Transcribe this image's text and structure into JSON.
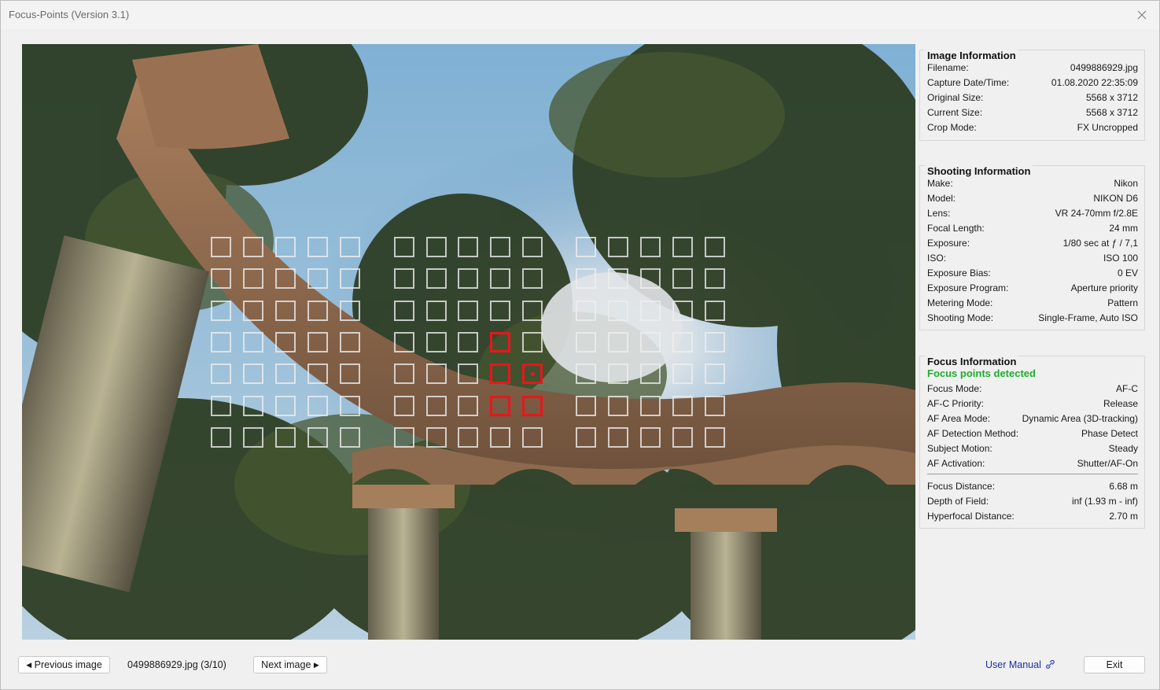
{
  "window": {
    "title": "Focus-Points (Version 3.1)",
    "close_icon": "close-icon"
  },
  "image_info": {
    "title": "Image Information",
    "rows": [
      {
        "label": "Filename:",
        "value": "0499886929.jpg"
      },
      {
        "label": "Capture Date/Time:",
        "value": "01.08.2020 22:35:09"
      },
      {
        "label": "Original Size:",
        "value": "5568 x 3712"
      },
      {
        "label": "Current Size:",
        "value": "5568 x 3712"
      },
      {
        "label": "Crop Mode:",
        "value": "FX Uncropped"
      }
    ]
  },
  "shooting_info": {
    "title": "Shooting Information",
    "rows": [
      {
        "label": "Make:",
        "value": "Nikon"
      },
      {
        "label": "Model:",
        "value": "NIKON D6"
      },
      {
        "label": "Lens:",
        "value": "VR 24-70mm f/2.8E"
      },
      {
        "label": "Focal Length:",
        "value": "24 mm"
      },
      {
        "label": "Exposure:",
        "value": "1/80 sec at ƒ / 7,1"
      },
      {
        "label": "ISO:",
        "value": "ISO 100"
      },
      {
        "label": "Exposure Bias:",
        "value": "0 EV"
      },
      {
        "label": "Exposure Program:",
        "value": "Aperture priority"
      },
      {
        "label": "Metering Mode:",
        "value": "Pattern"
      },
      {
        "label": "Shooting Mode:",
        "value": "Single-Frame, Auto ISO"
      }
    ]
  },
  "focus_info": {
    "title": "Focus Information",
    "status": "Focus points detected",
    "status_color": "#1eae2c",
    "rows": [
      {
        "label": "Focus Mode:",
        "value": "AF-C"
      },
      {
        "label": "AF-C Priority:",
        "value": "Release"
      },
      {
        "label": "AF Area Mode:",
        "value": "Dynamic Area (3D-tracking)"
      },
      {
        "label": "AF Detection Method:",
        "value": "Phase Detect"
      },
      {
        "label": "Subject Motion:",
        "value": "Steady"
      },
      {
        "label": "AF Activation:",
        "value": "Shutter/AF-On"
      }
    ],
    "distance_rows": [
      {
        "label": "Focus Distance:",
        "value": "6.68 m"
      },
      {
        "label": "Depth of Field:",
        "value": "inf (1.93 m - inf)"
      },
      {
        "label": "Hyperfocal Distance:",
        "value": "2.70 m"
      }
    ]
  },
  "af_grid": {
    "rows": 7,
    "columns": 16,
    "active_color": "#e8161b",
    "active_points": [
      {
        "row": 3,
        "col": 8
      },
      {
        "row": 4,
        "col": 8
      },
      {
        "row": 4,
        "col": 9,
        "primary": true
      },
      {
        "row": 5,
        "col": 8
      },
      {
        "row": 5,
        "col": 9
      }
    ]
  },
  "footer": {
    "prev_label": "Previous image",
    "prev_icon": "triangle-left-icon",
    "current_file": "0499886929.jpg (3/10)",
    "next_label": "Next image",
    "next_icon": "triangle-right-icon",
    "manual_label": "User Manual",
    "manual_icon": "link-icon",
    "exit_label": "Exit"
  }
}
